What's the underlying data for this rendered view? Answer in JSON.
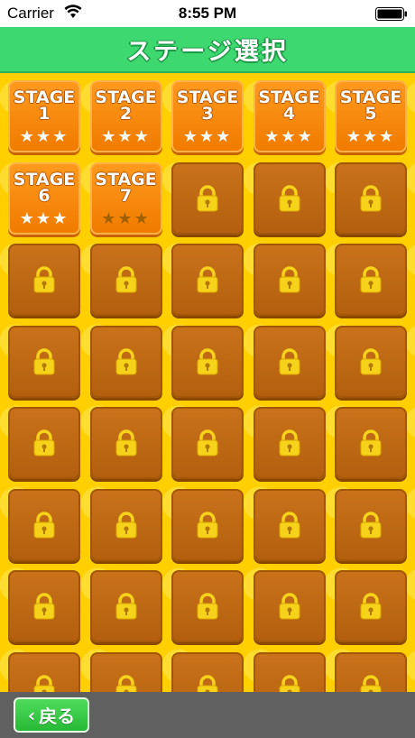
{
  "status_bar": {
    "carrier": "Carrier",
    "time": "8:55 PM"
  },
  "header": {
    "title": "ステージ選択"
  },
  "stages": [
    {
      "label": "STAGE",
      "number": "1",
      "stars": 3,
      "locked": false
    },
    {
      "label": "STAGE",
      "number": "2",
      "stars": 3,
      "locked": false
    },
    {
      "label": "STAGE",
      "number": "3",
      "stars": 3,
      "locked": false
    },
    {
      "label": "STAGE",
      "number": "4",
      "stars": 3,
      "locked": false
    },
    {
      "label": "STAGE",
      "number": "5",
      "stars": 3,
      "locked": false
    },
    {
      "label": "STAGE",
      "number": "6",
      "stars": 3,
      "locked": false
    },
    {
      "label": "STAGE",
      "number": "7",
      "stars": 0,
      "locked": false
    }
  ],
  "locked_tiles_visible": 33,
  "max_stars": 3,
  "colors": {
    "header_green": "#3ed870",
    "background_yellow": "#ffd400",
    "open_tile": "#f07b00",
    "locked_tile": "#b35f0e",
    "back_button": "#27b936"
  },
  "icons": {
    "lock": "padlock-icon",
    "star": "star-icon",
    "back": "chevron-left-icon"
  },
  "footer": {
    "back_label": "戻る"
  }
}
